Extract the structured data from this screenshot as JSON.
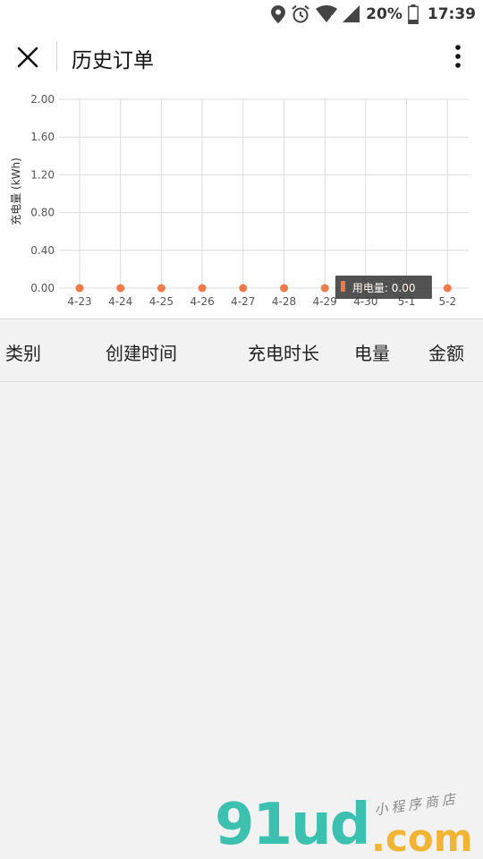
{
  "status_bar": {
    "battery": "20%",
    "time": "17:39"
  },
  "header": {
    "title": "历史订单"
  },
  "chart_data": {
    "type": "line",
    "categories": [
      "4-23",
      "4-24",
      "4-25",
      "4-26",
      "4-27",
      "4-28",
      "4-29",
      "4-30",
      "5-1",
      "5-2"
    ],
    "series": [
      {
        "name": "用电量",
        "values": [
          0,
          0,
          0,
          0,
          0,
          0,
          0,
          0,
          0,
          0
        ],
        "color": "#f07b4a"
      }
    ],
    "ylabel": "充电量 (kWh)",
    "yticks": [
      "0.00",
      "0.40",
      "0.80",
      "1.20",
      "1.60",
      "2.00"
    ],
    "ylim": [
      0,
      2
    ],
    "grid": true,
    "tooltip": {
      "category": "4-30",
      "label": "用电量",
      "value": "0.00"
    }
  },
  "table": {
    "headers": [
      "类别",
      "创建时间",
      "充电时长",
      "电量",
      "金额"
    ]
  },
  "watermark": {
    "main": "91ud",
    "suffix": ".com",
    "sub": "小程序商店"
  },
  "colors": {
    "accent": "#f07b4a",
    "watermark_teal": "#3cc0b0",
    "watermark_yellow": "#f2b434"
  }
}
